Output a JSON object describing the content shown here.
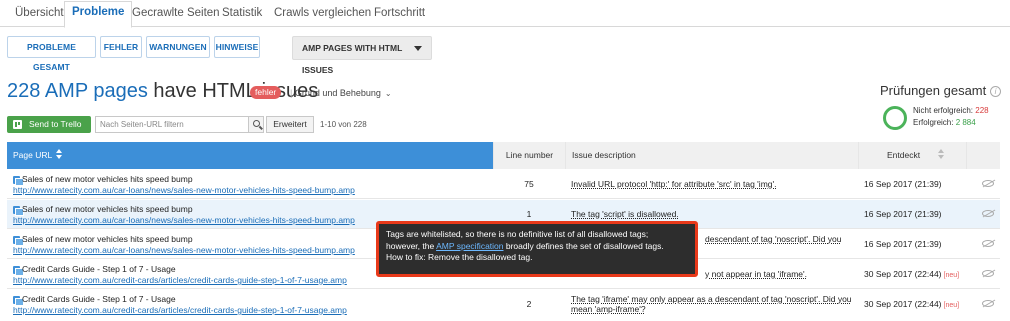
{
  "tabs": [
    {
      "label": "Übersicht"
    },
    {
      "label": "Probleme"
    },
    {
      "label": "Gecrawlte Seiten"
    },
    {
      "label": "Statistik"
    },
    {
      "label": "Crawls vergleichen"
    },
    {
      "label": "Fortschritt"
    }
  ],
  "filters": [
    {
      "label": "PROBLEME GESAMT"
    },
    {
      "label": "FEHLER"
    },
    {
      "label": "WARNUNGEN"
    },
    {
      "label": "HINWEISE"
    }
  ],
  "dropdown": {
    "label": "AMP PAGES WITH HTML ISSUES"
  },
  "heading": {
    "count": "228 AMP pages",
    "rest": " have HTML issues",
    "badge": "fehler",
    "reason": "Grund und Behebung"
  },
  "actions": {
    "trello": "Send to Trello",
    "search_placeholder": "Nach Seiten-URL filtern",
    "advanced": "Erweitert",
    "range": "1-10 von 228"
  },
  "summary": {
    "title": "Prüfungen gesamt",
    "failed_label": "Nicht erfolgreich: ",
    "failed": "228",
    "passed_label": "Erfolgreich: ",
    "passed": "2 884"
  },
  "table": {
    "headers": {
      "url": "Page URL",
      "line": "Line number",
      "desc": "Issue description",
      "date": "Entdeckt"
    },
    "rows": [
      {
        "title": "Sales of new motor vehicles hits speed bump",
        "url": "http://www.ratecity.com.au/car-loans/news/sales-new-motor-vehicles-hits-speed-bump.amp",
        "line": "75",
        "desc": "Invalid URL protocol 'http:' for attribute 'src' in tag 'img'.",
        "date": "16 Sep 2017 (21:39)",
        "neu": ""
      },
      {
        "title": "Sales of new motor vehicles hits speed bump",
        "url": "http://www.ratecity.com.au/car-loans/news/sales-new-motor-vehicles-hits-speed-bump.amp",
        "line": "1",
        "desc": "The tag 'script' is disallowed.",
        "date": "16 Sep 2017 (21:39)",
        "neu": ""
      },
      {
        "title": "Sales of new motor vehicles hits speed bump",
        "url": "http://www.ratecity.com.au/car-loans/news/sales-new-motor-vehicles-hits-speed-bump.amp",
        "line": "",
        "desc": "descendant of tag 'noscript'. Did you",
        "date": "16 Sep 2017 (21:39)",
        "neu": ""
      },
      {
        "title": "Credit Cards Guide - Step 1 of 7 - Usage",
        "url": "http://www.ratecity.com.au/credit-cards/articles/credit-cards-guide-step-1-of-7-usage.amp",
        "line": "",
        "desc": "y not appear in tag 'iframe'.",
        "date": "30 Sep 2017 (22:44)",
        "neu": "[neu]"
      },
      {
        "title": "Credit Cards Guide - Step 1 of 7 - Usage",
        "url": "http://www.ratecity.com.au/credit-cards/articles/credit-cards-guide-step-1-of-7-usage.amp",
        "line": "2",
        "desc": "The tag 'iframe' may only appear as a descendant of tag 'noscript'. Did you mean 'amp-iframe'?",
        "date": "30 Sep 2017 (22:44)",
        "neu": "[neu]"
      }
    ]
  },
  "tooltip": {
    "line1": "Tags are whitelisted, so there is no definitive list of all disallowed tags;",
    "line2_pre": "however, the ",
    "line2_link": "AMP specification",
    "line2_post": " broadly defines the set of disallowed tags.",
    "line3": "How to fix: Remove the disallowed tag."
  }
}
